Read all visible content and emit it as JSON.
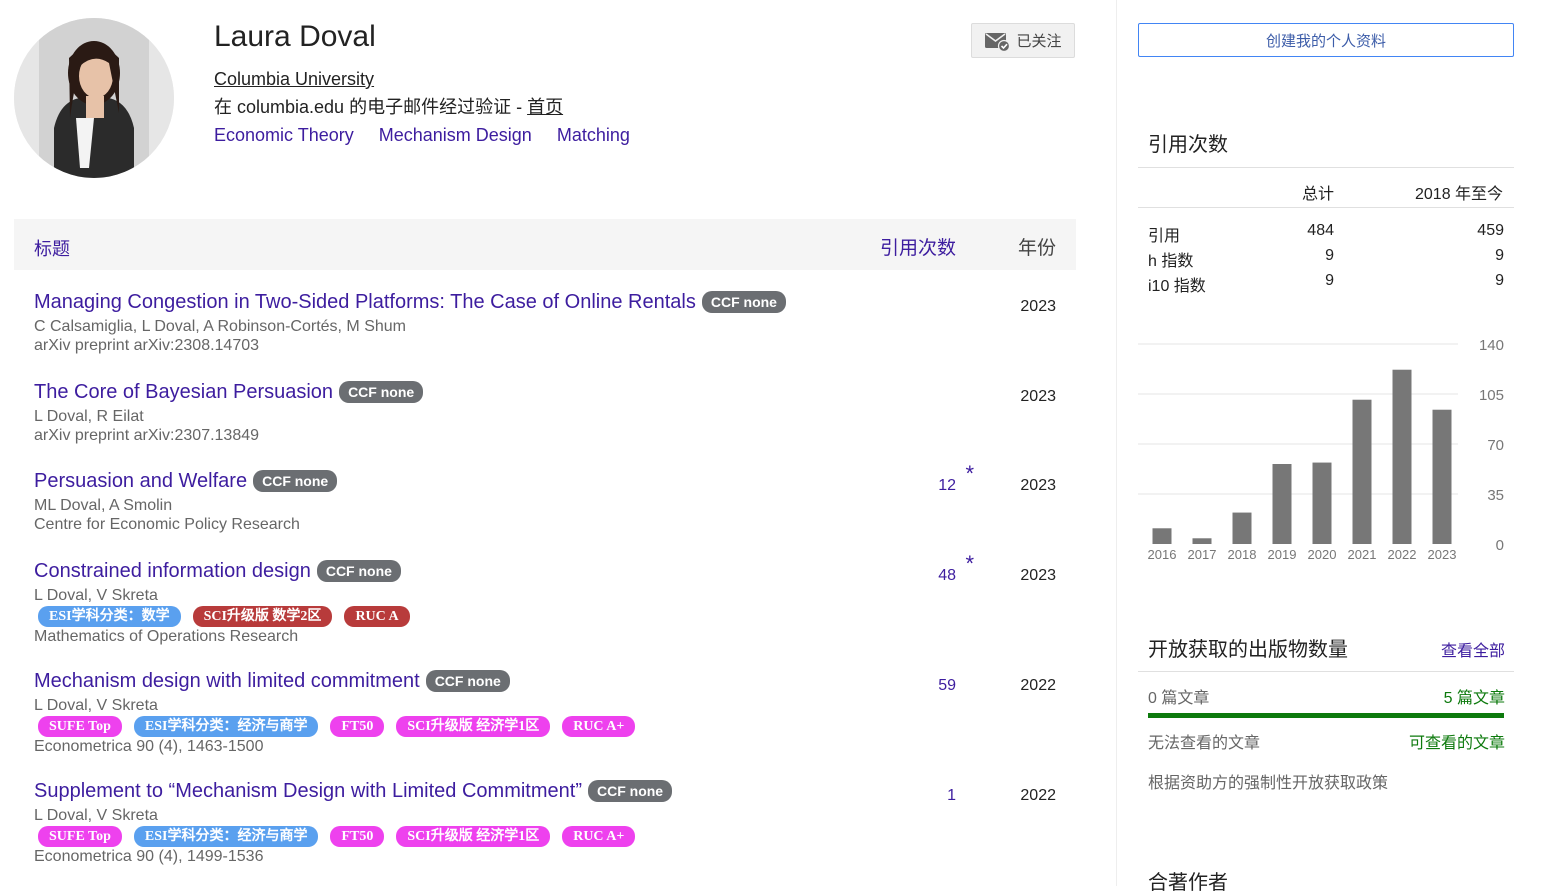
{
  "profile": {
    "name": "Laura Doval",
    "affiliation": "Columbia University",
    "verified_text": "在 columbia.edu 的电子邮件经过验证 - ",
    "homepage_label": "首页",
    "interests": [
      "Economic Theory",
      "Mechanism Design",
      "Matching"
    ],
    "follow_label": "已关注"
  },
  "table": {
    "col_title": "标题",
    "col_cited": "引用次数",
    "col_year": "年份"
  },
  "articles": [
    {
      "title": "Managing Congestion in Two-Sided Platforms: The Case of Online Rentals",
      "ccf": "CCF none",
      "authors": "C Calsamiglia, L Doval, A Robinson-Cortés, M Shum",
      "tags": [],
      "venue": "arXiv preprint arXiv:2308.14703",
      "cited": "",
      "star": "",
      "year": "2023"
    },
    {
      "title": "The Core of Bayesian Persuasion",
      "ccf": "CCF none",
      "authors": "L Doval, R Eilat",
      "tags": [],
      "venue": "arXiv preprint arXiv:2307.13849",
      "cited": "",
      "star": "",
      "year": "2023"
    },
    {
      "title": "Persuasion and Welfare",
      "ccf": "CCF none",
      "authors": "ML Doval, A Smolin",
      "tags": [],
      "venue": "Centre for Economic Policy Research",
      "cited": "12",
      "star": "*",
      "year": "2023"
    },
    {
      "title": "Constrained information design",
      "ccf": "CCF none",
      "authors": "L Doval, V Skreta",
      "tags": [
        {
          "label": "ESI学科分类：数学",
          "color": "blue"
        },
        {
          "label": "SCI升级版 数学2区",
          "color": "red"
        },
        {
          "label": "RUC A",
          "color": "red"
        }
      ],
      "venue": "Mathematics of Operations Research",
      "cited": "48",
      "star": "*",
      "year": "2023"
    },
    {
      "title": "Mechanism design with limited commitment",
      "ccf": "CCF none",
      "authors": "L Doval, V Skreta",
      "tags": [
        {
          "label": "SUFE Top",
          "color": "pink"
        },
        {
          "label": "ESI学科分类：经济与商学",
          "color": "blue"
        },
        {
          "label": "FT50",
          "color": "pink"
        },
        {
          "label": "SCI升级版 经济学1区",
          "color": "pink"
        },
        {
          "label": "RUC A+",
          "color": "pink"
        }
      ],
      "venue": "Econometrica 90 (4), 1463-1500",
      "cited": "59",
      "star": "",
      "year": "2022"
    },
    {
      "title": "Supplement to “Mechanism Design with Limited Commitment”",
      "ccf": "CCF none",
      "authors": "L Doval, V Skreta",
      "tags": [
        {
          "label": "SUFE Top",
          "color": "pink"
        },
        {
          "label": "ESI学科分类：经济与商学",
          "color": "blue"
        },
        {
          "label": "FT50",
          "color": "pink"
        },
        {
          "label": "SCI升级版 经济学1区",
          "color": "pink"
        },
        {
          "label": "RUC A+",
          "color": "pink"
        }
      ],
      "venue": "Econometrica 90 (4), 1499-1536",
      "cited": "1",
      "star": "",
      "year": "2022"
    }
  ],
  "sidebar": {
    "create_profile": "创建我的个人资料",
    "citations_title": "引用次数",
    "col_total": "总计",
    "col_since": "2018 年至今",
    "stats": [
      {
        "label": "引用",
        "total": "484",
        "since": "459"
      },
      {
        "label": "h 指数",
        "total": "9",
        "since": "9"
      },
      {
        "label": "i10 指数",
        "total": "9",
        "since": "9"
      }
    ],
    "oa_title": "开放获取的出版物数量",
    "oa_view_all": "查看全部",
    "oa_unavailable_count": "0 篇文章",
    "oa_available_count": "5 篇文章",
    "oa_unavailable_label": "无法查看的文章",
    "oa_available_label": "可查看的文章",
    "oa_policy": "根据资助方的强制性开放获取政策",
    "coauthors_title": "合著作者"
  },
  "chart_data": {
    "type": "bar",
    "categories": [
      "2016",
      "2017",
      "2018",
      "2019",
      "2020",
      "2021",
      "2022",
      "2023"
    ],
    "values": [
      11,
      4,
      22,
      56,
      57,
      101,
      122,
      94
    ],
    "ylim": [
      0,
      140
    ],
    "yticks": [
      "0",
      "35",
      "70",
      "105",
      "140"
    ],
    "bar_color": "#777777",
    "grid": true
  },
  "colors": {
    "link": "#3d1d9f",
    "ccf_badge": "#6b6e72",
    "oa_green": "#0d7a0d"
  }
}
